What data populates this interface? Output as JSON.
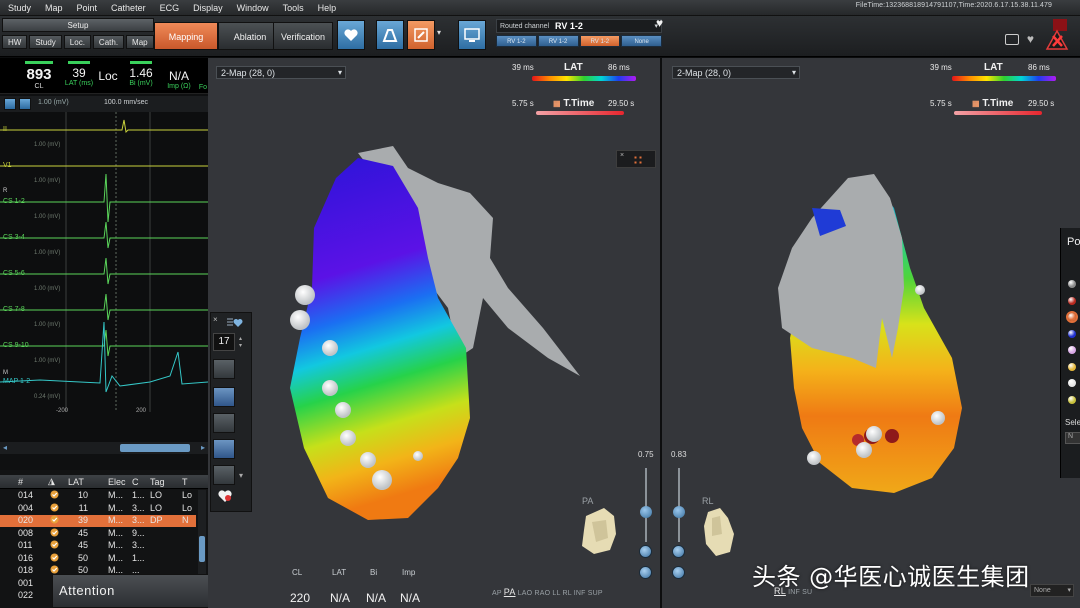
{
  "menu": [
    "Study",
    "Map",
    "Point",
    "Catheter",
    "ECG",
    "Display",
    "Window",
    "Tools",
    "Help"
  ],
  "filetime": "FileTime:132368818914791107,Time:2020.6.17.15.38.11.479",
  "toolbar": {
    "setup_label": "Setup",
    "setup_buttons": [
      "HW",
      "Study",
      "Loc.",
      "Cath.",
      "Map"
    ],
    "modes": [
      "Mapping",
      "Ablation",
      "Verification"
    ],
    "active_mode": "Mapping",
    "routed_label": "Routed channel",
    "routed_value": "RV 1-2",
    "routed_tabs": [
      "RV 1-2",
      "RV 1-2",
      "RV 1-2",
      "None"
    ]
  },
  "stats": {
    "cl_value": "893",
    "cl_label": "CL",
    "lat_value": "39",
    "lat_label": "LAT (ms)",
    "loc_value": "Loc",
    "bi_value": "1.46",
    "bi_label": "Bi (mV)",
    "imp_value": "N/A",
    "imp_label": "Imp (Ω)",
    "fo_label": "Fo"
  },
  "ecg": {
    "scale_top": "100.0 mm/sec",
    "channels": [
      {
        "name": "II",
        "mv": "1.00 (mV)",
        "color": "#c9d23c"
      },
      {
        "name": "V1",
        "mv": "1.00 (mV)",
        "color": "#c9d23c"
      },
      {
        "name": "CS 1-2",
        "mv": "1.00 (mV)",
        "color": "#5ad45a"
      },
      {
        "name": "CS 3-4",
        "mv": "1.00 (mV)",
        "color": "#5ad45a"
      },
      {
        "name": "CS 5-6",
        "mv": "1.00 (mV)",
        "color": "#5ad45a"
      },
      {
        "name": "CS 7-8",
        "mv": "1.00 (mV)",
        "color": "#5ad45a"
      },
      {
        "name": "CS 9-10",
        "mv": "1.00 (mV)",
        "color": "#5ad45a"
      },
      {
        "name": "MAP 1-2",
        "mv": "0.24 (mV)",
        "color": "#35c8c8"
      }
    ],
    "top_mv": "1.00 (mV)",
    "time_left": "-200",
    "time_right": "200",
    "markers": [
      "R",
      "M"
    ]
  },
  "points_table": {
    "headers": [
      "#",
      "",
      "LAT",
      "Elec",
      "C",
      "Tag",
      "T"
    ],
    "rows": [
      {
        "id": "014",
        "lat": "10",
        "elec": "M...",
        "c": "1...",
        "tag": "LO",
        "t": "Lo"
      },
      {
        "id": "004",
        "lat": "11",
        "elec": "M...",
        "c": "3...",
        "tag": "LO",
        "t": "Lo"
      },
      {
        "id": "020",
        "lat": "39",
        "elec": "M...",
        "c": "3...",
        "tag": "DP",
        "t": "N"
      },
      {
        "id": "008",
        "lat": "45",
        "elec": "M...",
        "c": "9...",
        "tag": "",
        "t": ""
      },
      {
        "id": "011",
        "lat": "45",
        "elec": "M...",
        "c": "3...",
        "tag": "",
        "t": ""
      },
      {
        "id": "016",
        "lat": "50",
        "elec": "M...",
        "c": "1...",
        "tag": "",
        "t": ""
      },
      {
        "id": "018",
        "lat": "50",
        "elec": "M...",
        "c": "...",
        "tag": "",
        "t": ""
      },
      {
        "id": "001",
        "lat": "",
        "elec": "",
        "c": "",
        "tag": "",
        "t": ""
      },
      {
        "id": "022",
        "lat": "",
        "elec": "",
        "c": "",
        "tag": "",
        "t": ""
      }
    ]
  },
  "attention": "Attention",
  "map1": {
    "selector": "2-Map (28, 0)",
    "lat_min": "39 ms",
    "lat_title": "LAT",
    "lat_max": "86 ms",
    "t_min": "5.75 s",
    "t_title": "T.Time",
    "t_max": "29.50 s",
    "slider_value": "0.75",
    "orient_label": "PA",
    "bottom_headers": [
      "CL",
      "LAT",
      "Bi",
      "Imp"
    ],
    "bottom_values": [
      "220",
      "N/A",
      "N/A",
      "N/A"
    ],
    "views": [
      "AP",
      "PA",
      "LAO",
      "RAO",
      "LL",
      "RL",
      "INF",
      "SUP"
    ],
    "active_view": "PA",
    "side_count": "17"
  },
  "map2": {
    "selector": "2-Map (28, 0)",
    "lat_min": "39 ms",
    "lat_title": "LAT",
    "lat_max": "86 ms",
    "t_min": "5.75 s",
    "t_title": "T.Time",
    "t_max": "29.50 s",
    "slider_value": "0.83",
    "orient_label": "RL",
    "views": [
      "RL",
      "INF",
      "SU"
    ],
    "active_view": "RL"
  },
  "right_panel": {
    "title": "Po",
    "sel_label": "Sele",
    "field_label": "N",
    "dot_colors": [
      "#8a8a8a",
      "#b8281e",
      "#e2703a",
      "#1f2fd0",
      "#d9a7e6",
      "#e6b83a",
      "#e6e6e6",
      "#c7c03a"
    ]
  },
  "none_label": "None",
  "watermark": "头条 @华医心诚医生集团"
}
